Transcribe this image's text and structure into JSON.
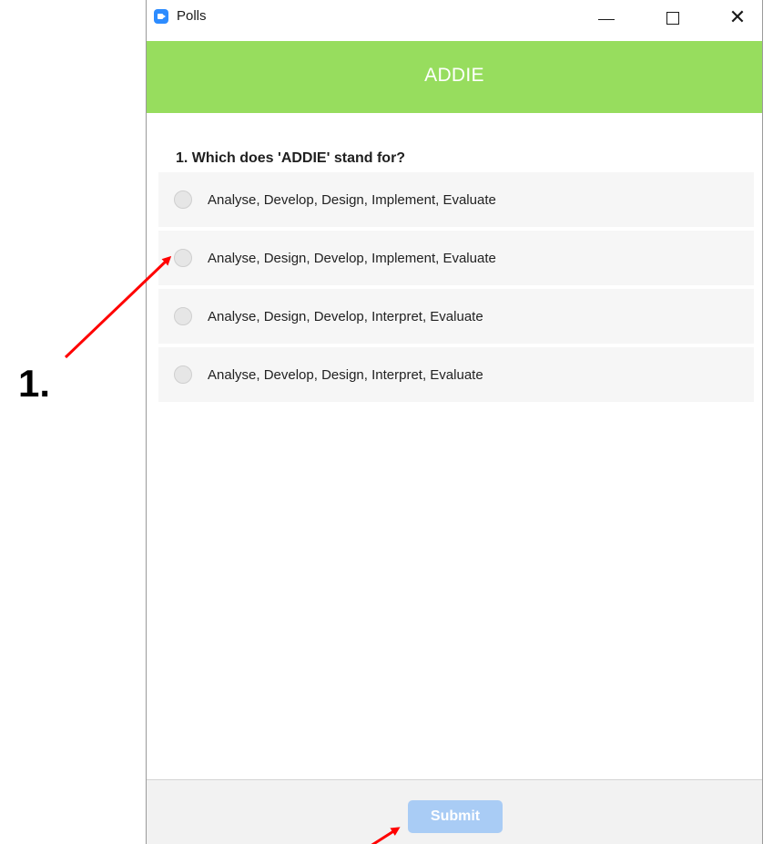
{
  "window": {
    "title": "Polls",
    "icon": "zoom-app-icon",
    "controls": [
      "minimize-icon",
      "maximize-icon",
      "close-icon"
    ]
  },
  "poll": {
    "title": "ADDIE",
    "header_color": "#97dd5e",
    "question": "1. Which does 'ADDIE' stand for?",
    "options": [
      {
        "label": "Analyse, Develop, Design, Implement, Evaluate",
        "selected": false
      },
      {
        "label": "Analyse, Design, Develop, Implement, Evaluate",
        "selected": false
      },
      {
        "label": "Analyse, Design, Develop, Interpret, Evaluate",
        "selected": false
      },
      {
        "label": "Analyse, Develop, Design, Interpret, Evaluate",
        "selected": false
      }
    ]
  },
  "footer": {
    "submit_label": "Submit",
    "submit_color": "#a9ccf5"
  },
  "annotation": {
    "label": "1.",
    "arrow_color": "#ff0000"
  }
}
